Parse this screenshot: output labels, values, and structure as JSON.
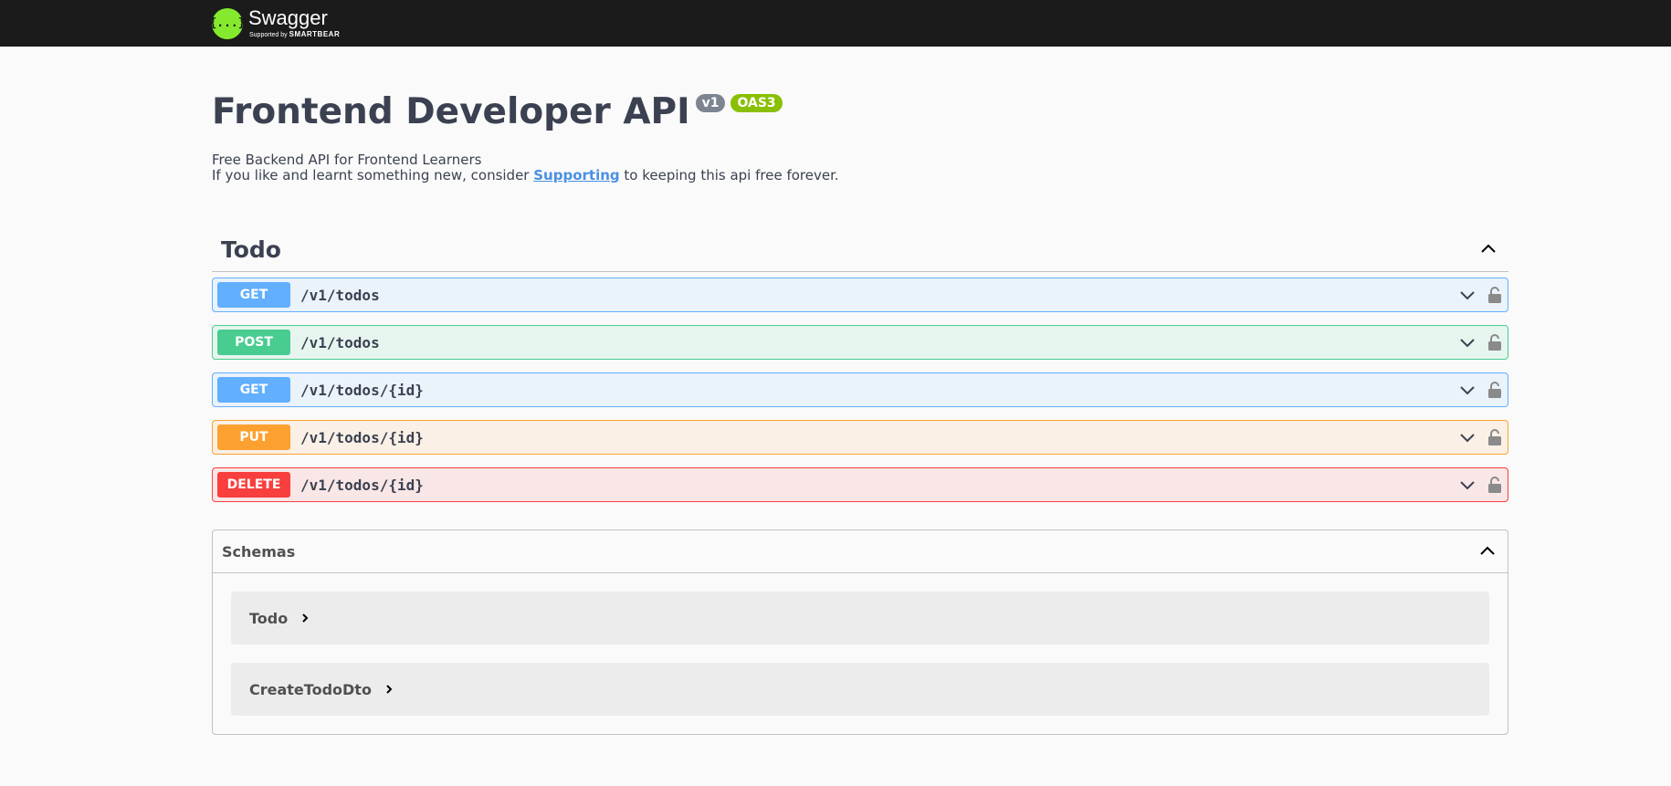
{
  "topbar": {
    "brand": "Swagger",
    "tagline_prefix": "Supported by",
    "tagline_brand": "SMARTBEAR",
    "logo_icon_text": "{...}"
  },
  "info": {
    "title": "Frontend Developer API",
    "version": "v1",
    "spec": "OAS3",
    "description_line1": "Free Backend API for Frontend Learners",
    "description_line2_before": "If you like and learnt something new, consider ",
    "description_link": "Supporting",
    "description_line2_after": " to keeping this api free forever."
  },
  "tag": {
    "name": "Todo"
  },
  "operations": [
    {
      "method": "GET",
      "path": "/v1/todos"
    },
    {
      "method": "POST",
      "path": "/v1/todos"
    },
    {
      "method": "GET",
      "path": "/v1/todos/{id}"
    },
    {
      "method": "PUT",
      "path": "/v1/todos/{id}"
    },
    {
      "method": "DELETE",
      "path": "/v1/todos/{id}"
    }
  ],
  "schemas": {
    "title": "Schemas",
    "models": [
      "Todo",
      "CreateTodoDto"
    ]
  },
  "colors": {
    "get": "#61affe",
    "post": "#49cc90",
    "put": "#fca130",
    "delete": "#f93e3e",
    "brand_green": "#85ea2d",
    "topbar": "#1b1b1b"
  },
  "icons": {
    "collapse": "chevron-up-icon",
    "expand": "chevron-down-icon",
    "lock": "lock-icon",
    "model_expand": "chevron-right-icon"
  }
}
